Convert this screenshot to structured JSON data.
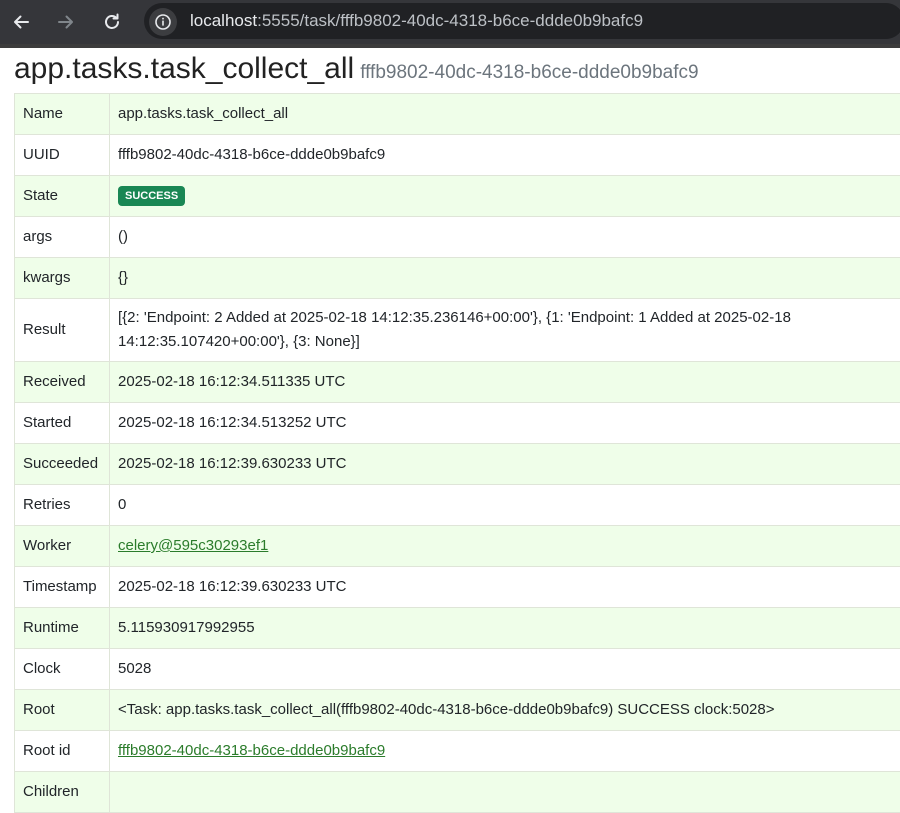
{
  "browser": {
    "url_host": "localhost",
    "url_rest": ":5555/task/fffb9802-40dc-4318-b6ce-ddde0b9bafc9"
  },
  "page": {
    "title": "app.tasks.task_collect_all",
    "subtitle": "fffb9802-40dc-4318-b6ce-ddde0b9bafc9"
  },
  "colors": {
    "row_odd": "#effee9",
    "row_even": "#ffffff",
    "badge_success": "#198754",
    "link": "#2b7c2b"
  },
  "rows": {
    "name": {
      "key": "Name",
      "value": "app.tasks.task_collect_all"
    },
    "uuid": {
      "key": "UUID",
      "value": "fffb9802-40dc-4318-b6ce-ddde0b9bafc9"
    },
    "state": {
      "key": "State",
      "value": "SUCCESS"
    },
    "args": {
      "key": "args",
      "value": "()"
    },
    "kwargs": {
      "key": "kwargs",
      "value": "{}"
    },
    "result": {
      "key": "Result",
      "value": "[{2: 'Endpoint: 2 Added at 2025-02-18 14:12:35.236146+00:00'}, {1: 'Endpoint: 1 Added at 2025-02-18 14:12:35.107420+00:00'}, {3: None}]"
    },
    "received": {
      "key": "Received",
      "value": "2025-02-18 16:12:34.511335 UTC"
    },
    "started": {
      "key": "Started",
      "value": "2025-02-18 16:12:34.513252 UTC"
    },
    "succeeded": {
      "key": "Succeeded",
      "value": "2025-02-18 16:12:39.630233 UTC"
    },
    "retries": {
      "key": "Retries",
      "value": "0"
    },
    "worker": {
      "key": "Worker",
      "value": "celery@595c30293ef1"
    },
    "timestamp": {
      "key": "Timestamp",
      "value": "2025-02-18 16:12:39.630233 UTC"
    },
    "runtime": {
      "key": "Runtime",
      "value": "5.115930917992955"
    },
    "clock": {
      "key": "Clock",
      "value": "5028"
    },
    "root": {
      "key": "Root",
      "value": "<Task: app.tasks.task_collect_all(fffb9802-40dc-4318-b6ce-ddde0b9bafc9) SUCCESS clock:5028>"
    },
    "root_id": {
      "key": "Root id",
      "value": "fffb9802-40dc-4318-b6ce-ddde0b9bafc9"
    },
    "children": {
      "key": "Children",
      "value": ""
    }
  }
}
